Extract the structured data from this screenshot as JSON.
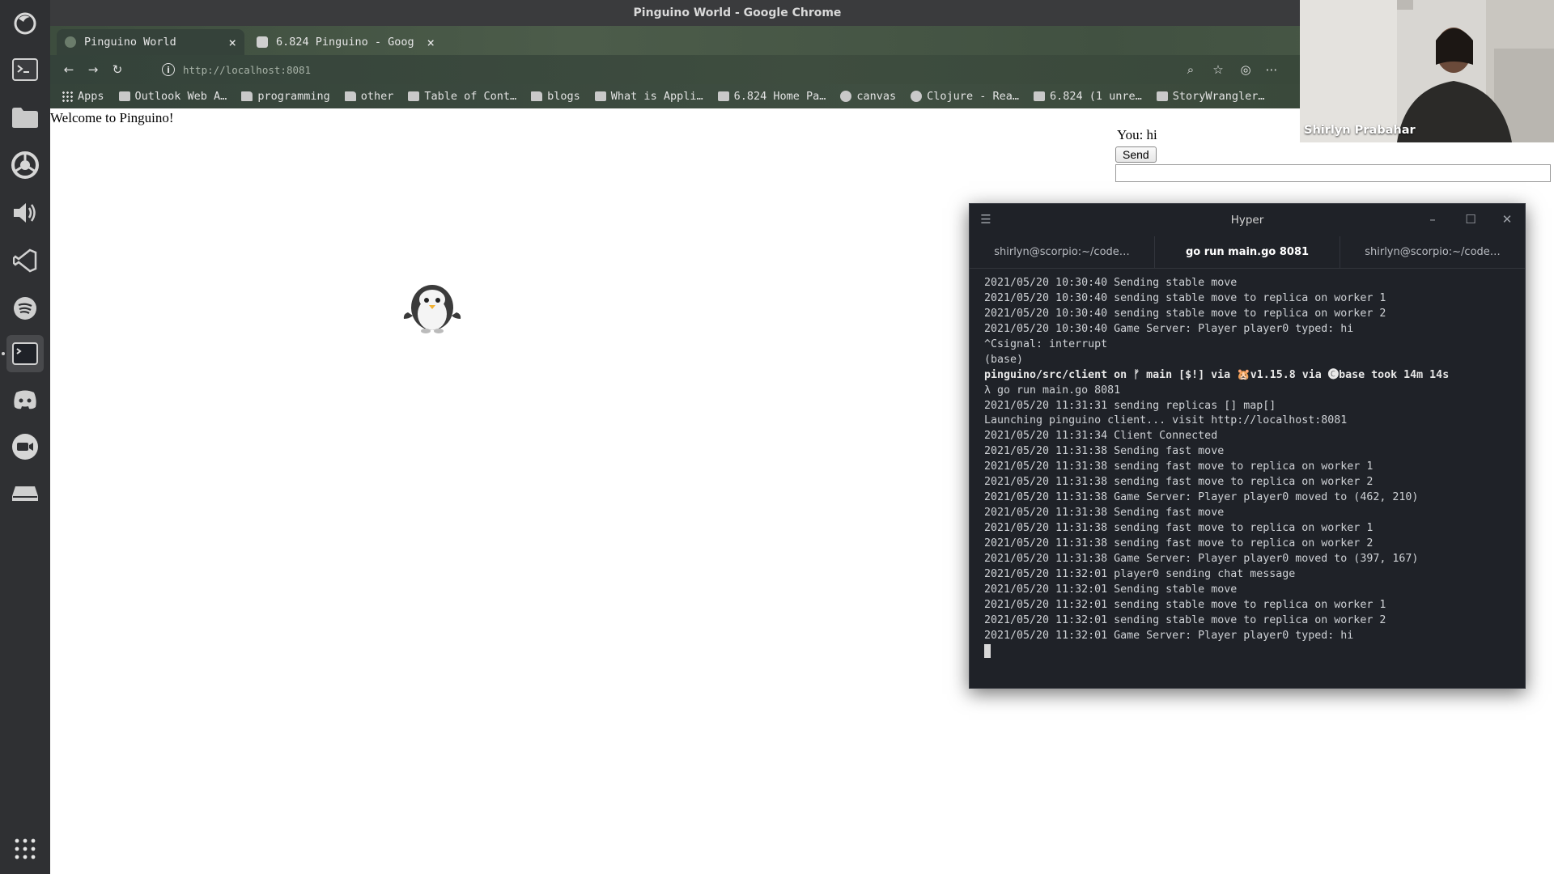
{
  "window": {
    "title": "Pinguino World - Google Chrome"
  },
  "tabs": [
    {
      "title": "Pinguino World",
      "close": "×",
      "active": true
    },
    {
      "title": "6.824 Pinguino - Goog",
      "close": "×",
      "active": false
    }
  ],
  "new_tab_symbol": "+",
  "address_bar": {
    "url_host": "http://localhost",
    "url_port": ":8081"
  },
  "bookmarks": [
    {
      "label": "Apps",
      "icon": "apps-grid-icon"
    },
    {
      "label": "Outlook Web A…",
      "icon": "outlook-icon"
    },
    {
      "label": "programming",
      "icon": "folder-icon"
    },
    {
      "label": "other",
      "icon": "folder-icon"
    },
    {
      "label": "Table of Cont…",
      "icon": "page-icon"
    },
    {
      "label": "blogs",
      "icon": "folder-icon"
    },
    {
      "label": "What is Appli…",
      "icon": "page-icon"
    },
    {
      "label": "6.824 Home Pa…",
      "icon": "page-icon"
    },
    {
      "label": "canvas",
      "icon": "canvas-icon"
    },
    {
      "label": "Clojure - Rea…",
      "icon": "clojure-icon"
    },
    {
      "label": "6.824 (1 unre…",
      "icon": "piazza-icon"
    },
    {
      "label": "StoryWrangler…",
      "icon": "page-icon"
    }
  ],
  "page": {
    "welcome_text": "Welcome to Pinguino!",
    "chat_log": "You: hi",
    "send_label": "Send",
    "chat_input_value": ""
  },
  "hyper": {
    "title": "Hyper",
    "tabs": [
      {
        "label": "shirlyn@scorpio:~/code…",
        "active": false
      },
      {
        "label": "go run main.go 8081",
        "active": true
      },
      {
        "label": "shirlyn@scorpio:~/code…",
        "active": false
      }
    ],
    "lines": [
      "2021/05/20 10:30:40 Sending stable move",
      "2021/05/20 10:30:40 sending stable move to replica on worker 1",
      "2021/05/20 10:30:40 sending stable move to replica on worker 2",
      "2021/05/20 10:30:40 Game Server: Player player0 typed: hi",
      "^Csignal: interrupt",
      "(base)",
      "pinguino/src/client on ᚠ main [$!] via 🐹v1.15.8 via 🅒base took 14m 14s",
      "λ go run main.go 8081",
      "2021/05/20 11:31:31 sending replicas [] map[]",
      "Launching pinguino client... visit http://localhost:8081",
      "2021/05/20 11:31:34 Client Connected",
      "2021/05/20 11:31:38 Sending fast move",
      "2021/05/20 11:31:38 sending fast move to replica on worker 1",
      "2021/05/20 11:31:38 sending fast move to replica on worker 2",
      "2021/05/20 11:31:38 Game Server: Player player0 moved to (462, 210)",
      "2021/05/20 11:31:38 Sending fast move",
      "2021/05/20 11:31:38 sending fast move to replica on worker 1",
      "2021/05/20 11:31:38 sending fast move to replica on worker 2",
      "2021/05/20 11:31:38 Game Server: Player player0 moved to (397, 167)",
      "2021/05/20 11:32:01 player0 sending chat message",
      "2021/05/20 11:32:01 Sending stable move",
      "2021/05/20 11:32:01 sending stable move to replica on worker 1",
      "2021/05/20 11:32:01 sending stable move to replica on worker 2",
      "2021/05/20 11:32:01 Game Server: Player player0 typed: hi"
    ]
  },
  "webcam": {
    "participant_name": "Shirlyn Prabahar"
  },
  "colors": {
    "dock_bg": "#2f3033",
    "terminal_bg": "#1f2228",
    "tab_green": "#4c5c4a"
  }
}
